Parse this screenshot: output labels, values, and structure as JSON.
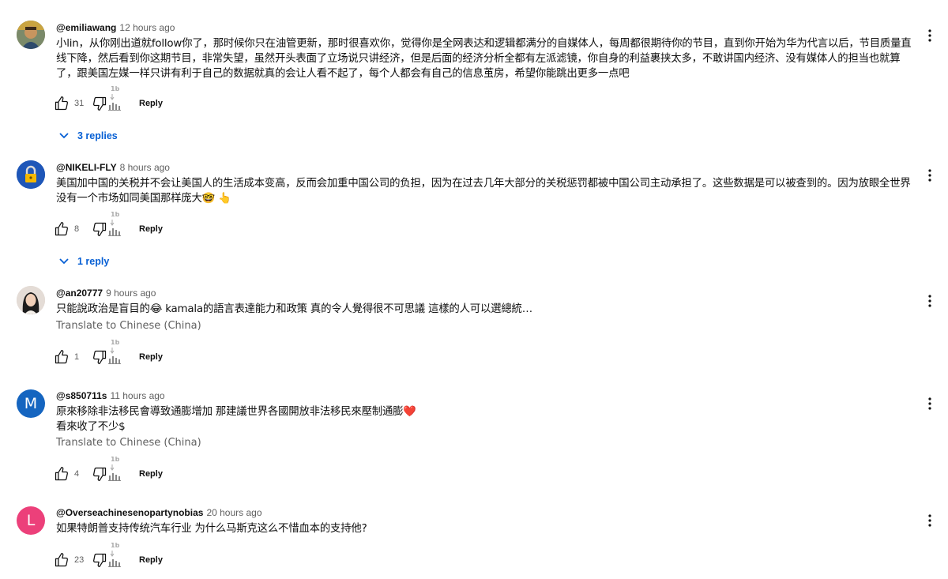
{
  "comments": [
    {
      "author": "@emiliawang",
      "time": "12 hours ago",
      "avatar": {
        "type": "image",
        "icon": "portrait-avatar",
        "bg": "#8a7a52"
      },
      "text": "小lin，从你刚出道就follow你了，那时候你只在油管更新，那时很喜欢你，觉得你是全网表达和逻辑都满分的自媒体人，每周都很期待你的节目，直到你开始为华为代言以后，节目质量直线下降，然后看到你这期节目，非常失望，虽然开头表面了立场说只讲经济，但是后面的经济分析全都有左派滤镜，你自身的利益裹挟太多，不敢讲国内经济、没有媒体人的担当也就算了，跟美国左媒一样只讲有利于自己的数据就真的会让人看不起了，每个人都会有自己的信息茧房，希望你能跳出更多一点吧",
      "translate": "",
      "likes": "31",
      "reply_label": "Reply",
      "replies_label": "3 replies"
    },
    {
      "author": "@NIKELI-FLY",
      "time": "8 hours ago",
      "avatar": {
        "type": "icon",
        "icon": "lock-avatar",
        "bg": "#1e56b8"
      },
      "text": "美国加中国的关税并不会让美国人的生活成本变高，反而会加重中国公司的负担，因为在过去几年大部分的关税惩罚都被中国公司主动承担了。这些数据是可以被查到的。因为放眼全世界没有一个市场如同美国那样庞大🤓 👆",
      "translate": "",
      "likes": "8",
      "reply_label": "Reply",
      "replies_label": "1 reply"
    },
    {
      "author": "@an20777",
      "time": "9 hours ago",
      "avatar": {
        "type": "image",
        "icon": "woman-portrait-avatar",
        "bg": "#d9c9c0"
      },
      "text": "只能說政治是盲目的😂 kamala的語言表達能力和政策 真的令人覺得很不可思議 這樣的人可以選總統…",
      "translate": "Translate to Chinese (China)",
      "likes": "1",
      "reply_label": "Reply",
      "replies_label": ""
    },
    {
      "author": "@s850711s",
      "time": "11 hours ago",
      "avatar": {
        "type": "letter",
        "letter": "M",
        "bg": "#1565c0"
      },
      "text": "原來移除非法移民會導致通膨增加 那建議世界各國開放非法移民來壓制通膨❤️\n看來收了不少$",
      "translate": "Translate to Chinese (China)",
      "likes": "4",
      "reply_label": "Reply",
      "replies_label": ""
    },
    {
      "author": "@Overseachinesenopartynobias",
      "time": "20 hours ago",
      "avatar": {
        "type": "letter",
        "letter": "L",
        "bg": "#ec407a"
      },
      "text": "如果特朗普支持传统汽车行业 为什么马斯克这么不惜血本的支持他?",
      "translate": "",
      "likes": "23",
      "reply_label": "Reply",
      "replies_label": ""
    }
  ],
  "colors": {
    "link": "#065fd4",
    "secondary": "#606060",
    "text": "#0f0f0f"
  }
}
